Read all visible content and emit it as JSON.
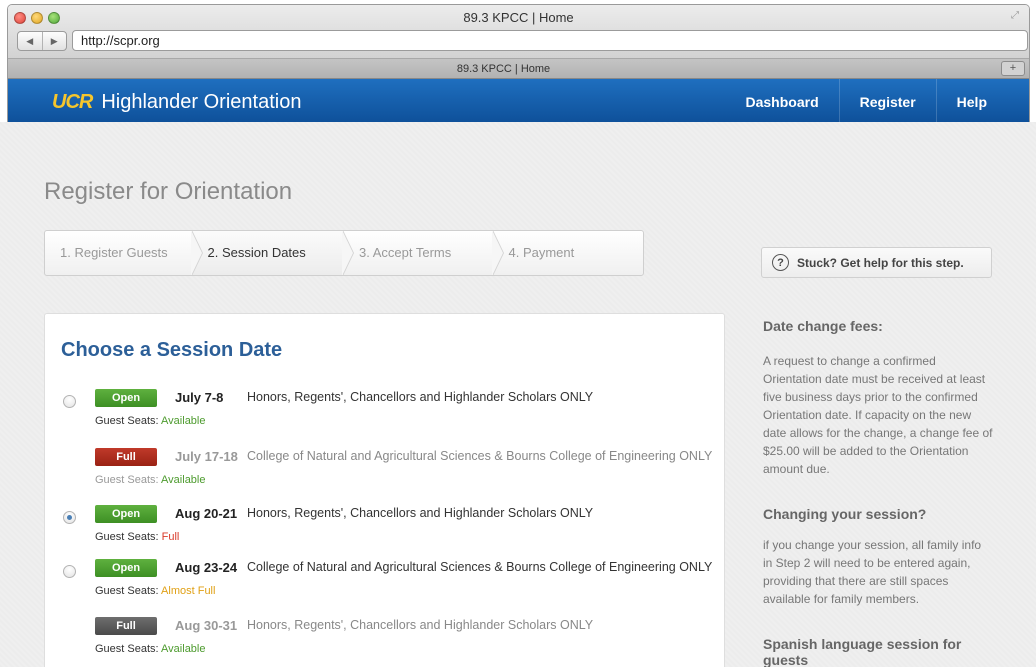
{
  "browser": {
    "window_title": "89.3 KPCC | Home",
    "url": "http://scpr.org",
    "tab_title": "89.3 KPCC | Home",
    "back_icon": "◀",
    "forward_icon": "▶",
    "new_tab_icon": "+"
  },
  "header": {
    "logo_mark": "UCR",
    "logo_name": "Highlander Orientation",
    "nav": [
      "Dashboard",
      "Register",
      "Help"
    ]
  },
  "page": {
    "title": "Register for Orientation",
    "steps": [
      {
        "label": "1. Register Guests",
        "active": false
      },
      {
        "label": "2. Session Dates",
        "active": true
      },
      {
        "label": "3. Accept Terms",
        "active": false
      },
      {
        "label": "4. Payment",
        "active": false
      }
    ],
    "help_button": "Stuck? Get help for this step.",
    "help_icon": "?"
  },
  "sessions_panel": {
    "title": "Choose a Session Date",
    "guest_seats_label": "Guest Seats:",
    "sessions": [
      {
        "status": "Open",
        "date": "July 7-8",
        "description": "Honors, Regents', Chancellors and Highlander Scholars ONLY",
        "guest_seats": "Available",
        "selected": false
      },
      {
        "status": "Full",
        "date": "July 17-18",
        "description": "College of Natural and Agricultural Sciences & Bourns College of Engineering ONLY",
        "guest_seats": "Available",
        "selected": false
      },
      {
        "status": "Open",
        "date": "Aug 20-21",
        "description": "Honors, Regents', Chancellors and Highlander Scholars ONLY",
        "guest_seats": "Full",
        "selected": true
      },
      {
        "status": "Open",
        "date": "Aug 23-24",
        "description": "College of Natural and Agricultural Sciences & Bourns College of Engineering ONLY",
        "guest_seats": "Almost Full",
        "selected": false
      },
      {
        "status": "Full",
        "date": "Aug 30-31",
        "description": "Honors, Regents', Chancellors and Highlander Scholars ONLY",
        "guest_seats": "Available",
        "selected": false
      }
    ]
  },
  "sidebar": {
    "sections": [
      {
        "heading": "Date change fees:",
        "text": "A request to change a confirmed Orientation date must be received at least five business days prior to the confirmed Orientation date. If capacity on the new date allows for the change, a change fee of $25.00 will be added to the Orientation amount due."
      },
      {
        "heading": "Changing your session?",
        "text": "if you change your session, all family info in Step 2 will need to be entered again, providing that there are still spaces available for family members."
      },
      {
        "heading": "Spanish language session for guests",
        "text": ""
      }
    ]
  },
  "colors": {
    "header_blue": "#1565b2",
    "logo_gold": "#f6c62c",
    "open_green": "#4aa12f",
    "full_red": "#b02e1f",
    "title_blue": "#2c5f98"
  }
}
